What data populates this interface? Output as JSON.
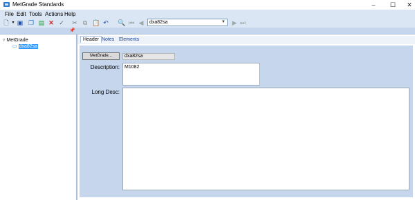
{
  "window": {
    "title": "MetGrade Standards",
    "minimize": "–",
    "maximize": "☐",
    "close": "✕"
  },
  "menu": [
    "File",
    "Edit",
    "Tools",
    "Actions",
    "Help"
  ],
  "toolbar": {
    "combo_value": "dxa82sa",
    "icons": [
      "new-icon",
      "dropdown-arrow-icon",
      "save-icon",
      "copy-doc-icon",
      "export-icon",
      "delete-icon",
      "check-icon",
      "cut-icon",
      "copy-icon",
      "paste-icon",
      "undo-icon",
      "find-icon",
      "first-icon",
      "prev-icon",
      "next-icon",
      "last-icon"
    ]
  },
  "tree": {
    "root": "MetGrade",
    "child": "dxa82sa",
    "pin": "📌"
  },
  "tabs": [
    "Header",
    "Notes",
    "Elements"
  ],
  "form": {
    "metgrade_button": "MetGrade...",
    "code_value": "dxa82sa",
    "description_label": "Description:",
    "description_value": "M1082",
    "long_desc_label": "Long Desc:",
    "long_desc_value": ""
  },
  "colors": {
    "accent": "#2b7bd6",
    "panel": "#c5d6ed",
    "toolbar": "#dbe6f4",
    "selection": "#3399ff"
  }
}
